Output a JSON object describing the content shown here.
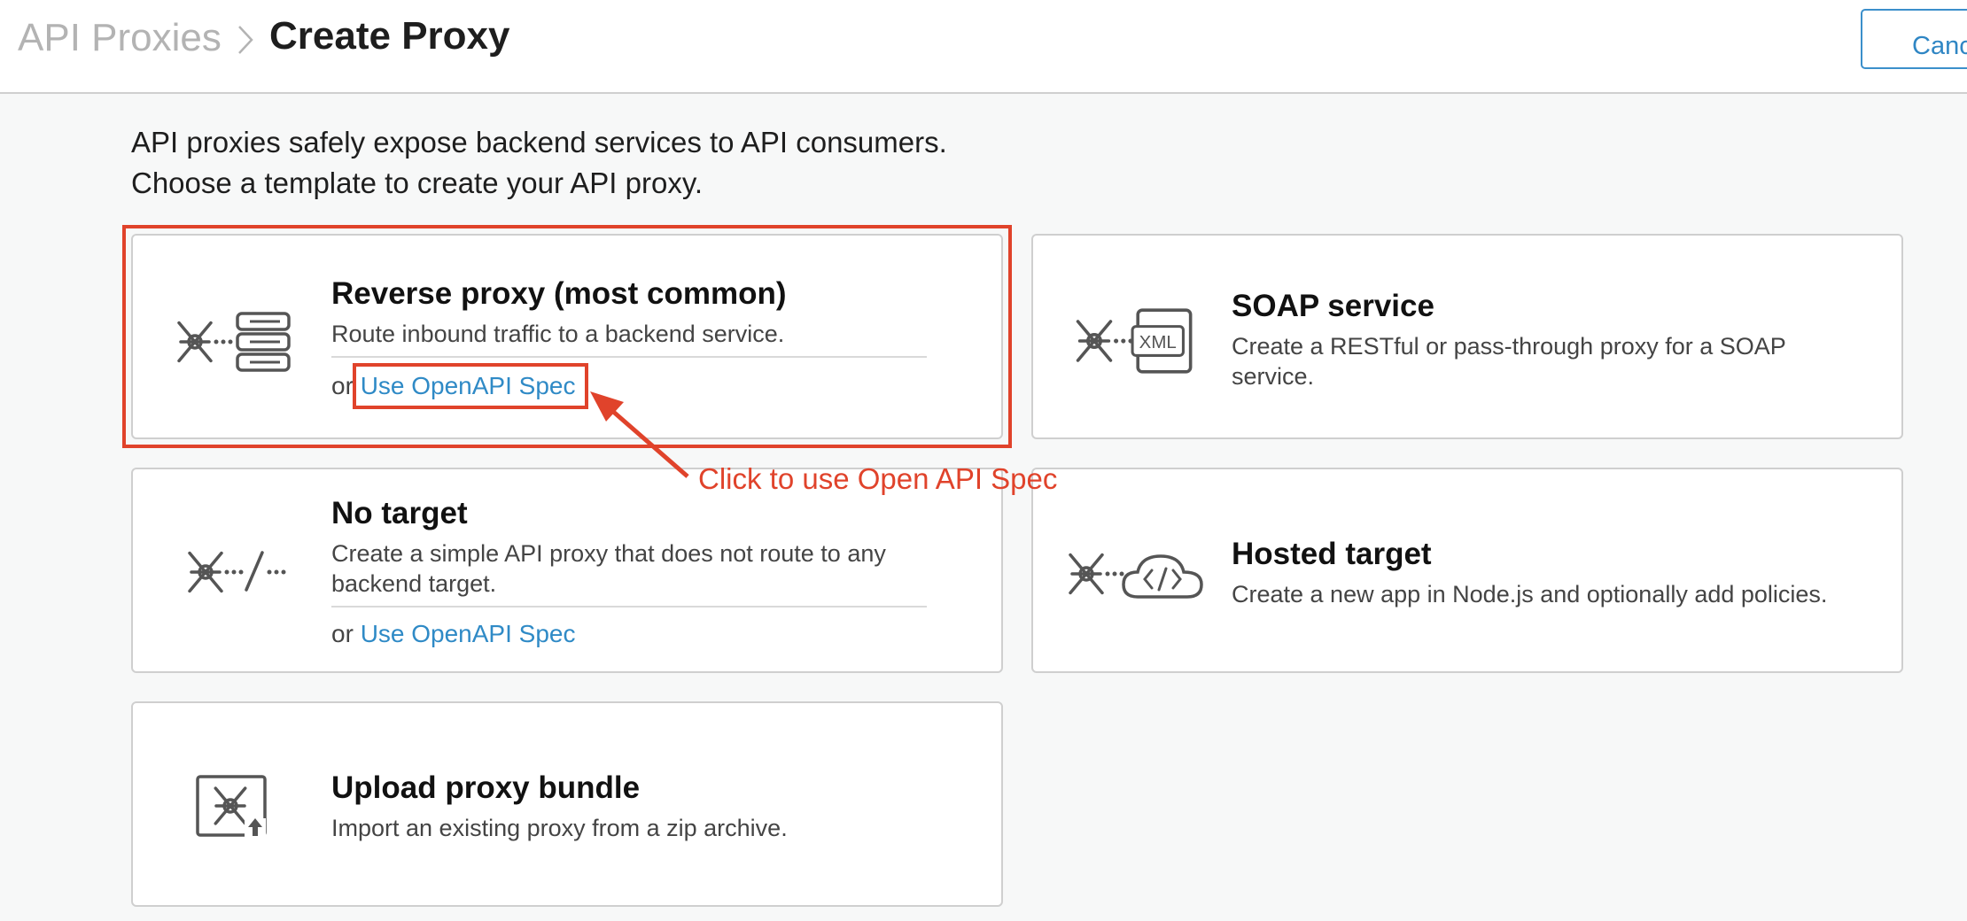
{
  "breadcrumb": {
    "parent": "API Proxies",
    "current": "Create Proxy"
  },
  "actions": {
    "cancel_label": "Canc"
  },
  "intro": {
    "line1": "API proxies safely expose backend services to API consumers.",
    "line2": "Choose a template to create your API proxy."
  },
  "cards": {
    "reverse_proxy": {
      "title": "Reverse proxy (most common)",
      "description": "Route inbound traffic to a backend service.",
      "or_text": "or ",
      "link": "Use OpenAPI Spec",
      "icon": "proxy-server-stack-icon"
    },
    "soap_service": {
      "title": "SOAP service",
      "description": "Create a RESTful or pass-through proxy for a SOAP service.",
      "icon": "proxy-xml-icon",
      "icon_text": "XML"
    },
    "no_target": {
      "title": "No target",
      "description": "Create a simple API proxy that does not route to any backend target.",
      "or_text": "or ",
      "link": "Use OpenAPI Spec",
      "icon": "proxy-no-target-icon"
    },
    "hosted_target": {
      "title": "Hosted target",
      "description": "Create a new app in Node.js and optionally add policies.",
      "icon": "proxy-cloud-code-icon"
    },
    "upload_bundle": {
      "title": "Upload proxy bundle",
      "description": "Import an existing proxy from a zip archive.",
      "icon": "upload-bundle-icon"
    }
  },
  "annotation": {
    "text": "Click to use Open API Spec",
    "color": "#e0432b"
  },
  "colors": {
    "link": "#2f8ac6",
    "accent_border": "#3b8fcb",
    "annotation": "#e0432b"
  }
}
